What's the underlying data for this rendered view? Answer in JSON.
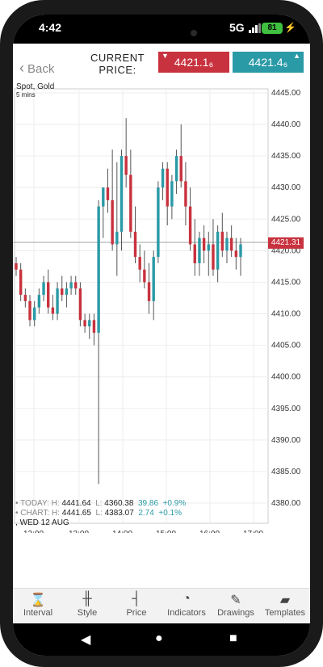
{
  "status": {
    "time": "4:42",
    "network": "5G",
    "battery": "81"
  },
  "header": {
    "back": "Back",
    "current_price_line1": "CURRENT",
    "current_price_line2": "PRICE:",
    "sell_price": "4421.1₆",
    "buy_price": "4421.4₆"
  },
  "chart_info": {
    "title": "Spot, Gold",
    "interval": "5 mins",
    "current_tag": "4421.31"
  },
  "chart_data": {
    "type": "candlestick",
    "x_labels": [
      "12:00",
      "13:00",
      "14:00",
      "15:00",
      "16:00",
      "17:00"
    ],
    "y_labels": [
      4445.0,
      4440.0,
      4435.0,
      4430.0,
      4425.0,
      4420.0,
      4415.0,
      4410.0,
      4405.0,
      4400.0,
      4395.0,
      4390.0,
      4385.0,
      4380.0
    ],
    "ylim": [
      4380,
      4445
    ],
    "current_price": 4421.31,
    "date_label": "WED 12 AUG",
    "ohlc": [
      [
        4418,
        4419,
        4416,
        4417
      ],
      [
        4417,
        4418,
        4412,
        4413
      ],
      [
        4413,
        4414,
        4411,
        4412
      ],
      [
        4412,
        4413,
        4408,
        4409
      ],
      [
        4409,
        4412,
        4408,
        4411
      ],
      [
        4411,
        4414,
        4410,
        4413
      ],
      [
        4413,
        4416,
        4412,
        4415
      ],
      [
        4415,
        4417,
        4410,
        4411
      ],
      [
        4411,
        4413,
        4409,
        4410
      ],
      [
        4410,
        4415,
        4409,
        4414
      ],
      [
        4414,
        4416,
        4412,
        4413
      ],
      [
        4413,
        4415,
        4411,
        4414
      ],
      [
        4414,
        4416,
        4413,
        4415
      ],
      [
        4415,
        4416,
        4413,
        4414
      ],
      [
        4414,
        4415,
        4408,
        4409
      ],
      [
        4409,
        4410,
        4407,
        4408
      ],
      [
        4408,
        4410,
        4406,
        4409
      ],
      [
        4409,
        4410,
        4405,
        4407
      ],
      [
        4407,
        4428,
        4383,
        4427
      ],
      [
        4427,
        4430,
        4422,
        4430
      ],
      [
        4430,
        4433,
        4426,
        4428
      ],
      [
        4428,
        4436,
        4420,
        4421
      ],
      [
        4421,
        4434,
        4416,
        4423
      ],
      [
        4423,
        4436,
        4420,
        4435
      ],
      [
        4435,
        4441,
        4430,
        4432
      ],
      [
        4432,
        4436,
        4422,
        4423
      ],
      [
        4423,
        4427,
        4418,
        4419
      ],
      [
        4419,
        4421,
        4415,
        4417
      ],
      [
        4417,
        4420,
        4414,
        4415
      ],
      [
        4415,
        4418,
        4410,
        4412
      ],
      [
        4412,
        4420,
        4409,
        4419
      ],
      [
        4419,
        4431,
        4418,
        4430
      ],
      [
        4430,
        4434,
        4428,
        4433
      ],
      [
        4433,
        4434,
        4424,
        4427
      ],
      [
        4427,
        4432,
        4425,
        4431
      ],
      [
        4431,
        4436,
        4429,
        4435
      ],
      [
        4435,
        4440,
        4430,
        4431
      ],
      [
        4431,
        4434,
        4424,
        4427
      ],
      [
        4427,
        4430,
        4420,
        4421
      ],
      [
        4421,
        4425,
        4416,
        4418
      ],
      [
        4418,
        4423,
        4416,
        4422
      ],
      [
        4422,
        4424,
        4418,
        4420
      ],
      [
        4420,
        4423,
        4416,
        4421
      ],
      [
        4421,
        4425,
        4416,
        4417
      ],
      [
        4417,
        4424,
        4415,
        4423
      ],
      [
        4423,
        4426,
        4419,
        4420
      ],
      [
        4420,
        4423,
        4418,
        4422
      ],
      [
        4422,
        4424,
        4419,
        4420
      ],
      [
        4420,
        4422,
        4417,
        4419
      ],
      [
        4419,
        4422,
        4416,
        4421
      ]
    ]
  },
  "today_stats": {
    "label": "TODAY:",
    "h_label": "H:",
    "h": "4441.64",
    "l_label": "L:",
    "l": "4360.38",
    "change": "39.86",
    "pct": "+0.9%"
  },
  "chart_stats": {
    "label": "CHART:",
    "h_label": "H:",
    "h": "4441.65",
    "l_label": "L:",
    "l": "4383.07",
    "change": "2.74",
    "pct": "+0.1%"
  },
  "tabs": [
    {
      "label": "Interval",
      "icon": "hourglass-icon"
    },
    {
      "label": "Style",
      "icon": "candlestick-icon"
    },
    {
      "label": "Price",
      "icon": "price-icon"
    },
    {
      "label": "Indicators",
      "icon": "gauge-icon"
    },
    {
      "label": "Drawings",
      "icon": "pencil-icon"
    },
    {
      "label": "Templates",
      "icon": "folder-icon"
    }
  ],
  "colors": {
    "up": "#2a9aa6",
    "down": "#c8323e",
    "accent": "#2a9aa6"
  }
}
